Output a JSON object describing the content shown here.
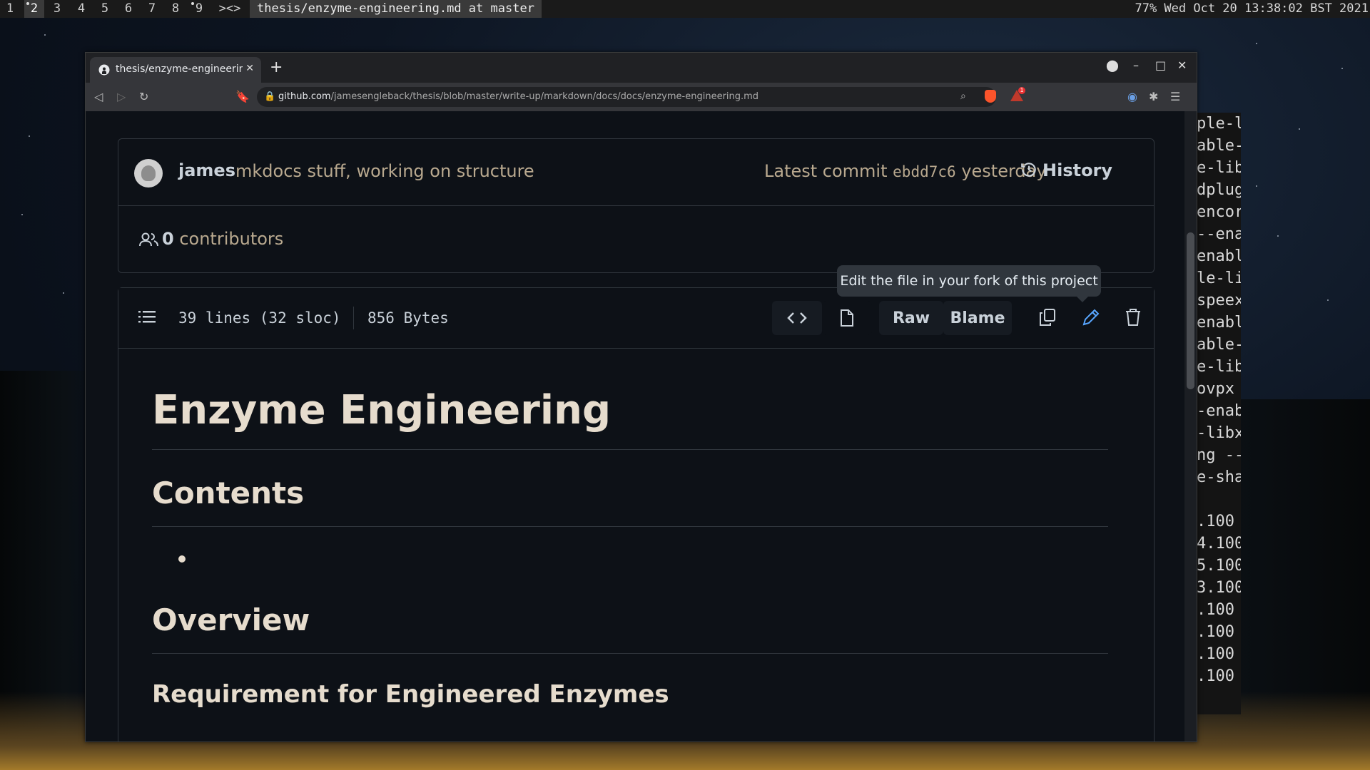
{
  "topbar": {
    "workspaces": [
      "1",
      "2",
      "3",
      "4",
      "5",
      "6",
      "7",
      "8",
      "9",
      "><>"
    ],
    "window_title": "thesis/enzyme-engineering.md at master",
    "status": "77% Wed Oct 20 13:38:02 BST 2021"
  },
  "terminal": {
    "lines": [
      "ple-l",
      "able-",
      "e-lib",
      "dplug",
      "encor",
      "--ena",
      "enabl",
      "le-li",
      "speex",
      "enabl",
      "able-",
      "e-lib",
      "ovpx",
      "-enab",
      "-libx",
      "ng --",
      "e-sha",
      "",
      ".100",
      "4.100",
      "5.100",
      "3.100",
      ".100",
      ".100",
      ".100",
      ".100"
    ]
  },
  "browser": {
    "tab_title": "thesis/enzyme-engineering.md",
    "url_domain": "github.com",
    "url_path": "/jamesengleback/thesis/blob/master/write-up/markdown/docs/docs/enzyme-engineering.md",
    "rewards_badge": "1"
  },
  "commit": {
    "author": "james",
    "message": "mkdocs stuff, working on structure",
    "latest_label": "Latest commit",
    "sha": "ebdd7c6",
    "when": "yesterday",
    "history_label": "History",
    "contributors_count": "0",
    "contributors_label": "contributors"
  },
  "file": {
    "lines": "39 lines (32 sloc)",
    "size": "856 Bytes",
    "raw_label": "Raw",
    "blame_label": "Blame",
    "tooltip": "Edit the file in your fork of this project"
  },
  "markdown": {
    "h1": "Enzyme Engineering",
    "contents": "Contents",
    "overview": "Overview",
    "requirement": "Requirement for Engineered Enzymes"
  },
  "colors": {
    "page_bg": "#0d1117",
    "border": "#30363d",
    "heading": "#e6dccd",
    "muted": "#b9a98f"
  }
}
